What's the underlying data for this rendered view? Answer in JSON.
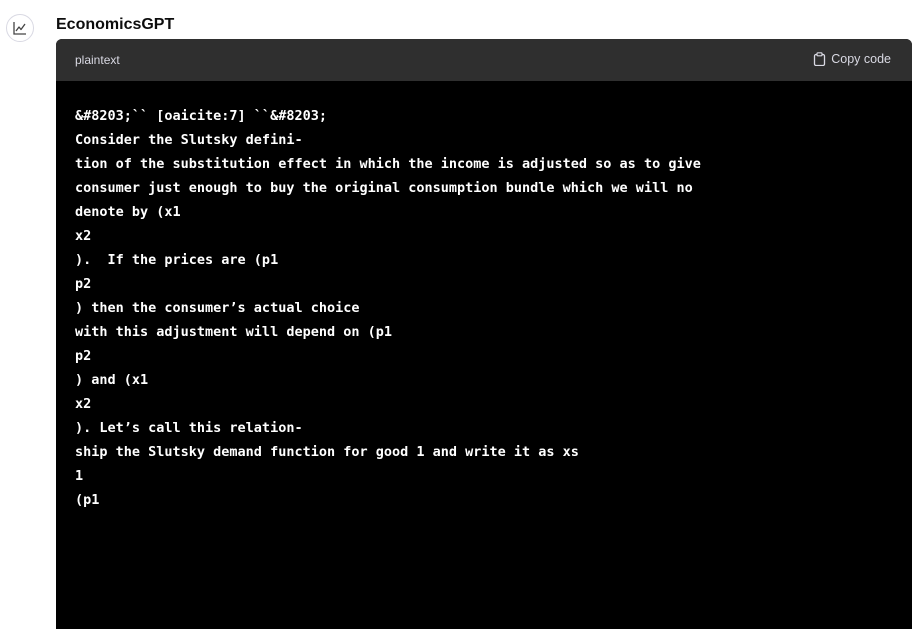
{
  "message": {
    "author": "EconomicsGPT",
    "avatar_icon": "line-chart-icon"
  },
  "code_block": {
    "language": "plaintext",
    "copy_label": "Copy code",
    "copy_icon": "clipboard-icon",
    "background": "#000000",
    "header_background": "#2f2f2f",
    "lines": [
      "&#8203;`` [oaicite:7] ``&#8203;",
      "Consider the Slutsky defini-",
      "tion of the substitution effect in which the income is adjusted so as to give",
      "consumer just enough to buy the original consumption bundle which we will no",
      "denote by (x1",
      "x2",
      ").  If the prices are (p1",
      "p2",
      ") then the consumer’s actual choice",
      "with this adjustment will depend on (p1",
      "p2",
      ") and (x1",
      "x2",
      "). Let’s call this relation-",
      "ship the Slutsky demand function for good 1 and write it as xs",
      "1",
      "(p1"
    ]
  }
}
